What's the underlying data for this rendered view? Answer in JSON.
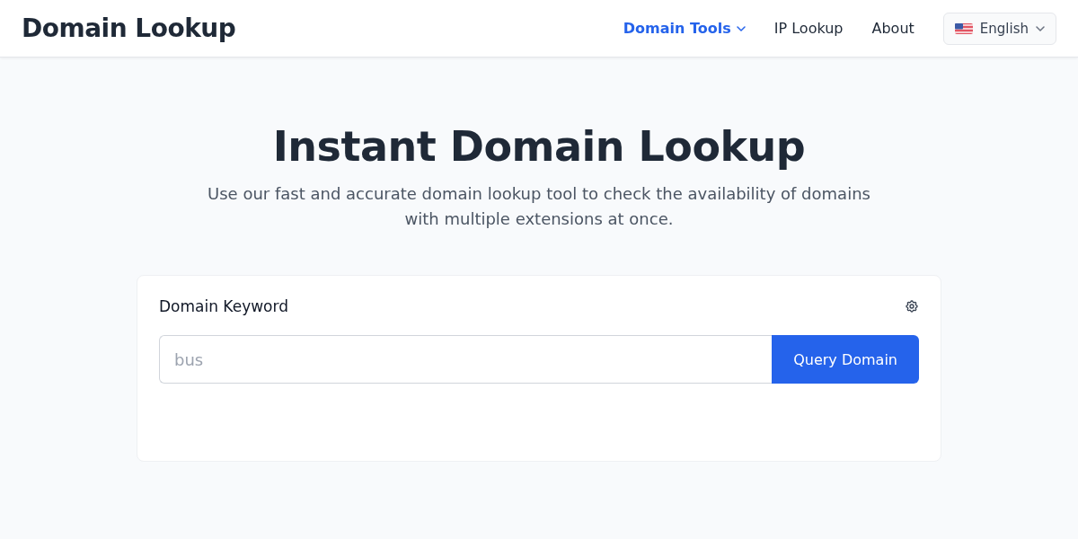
{
  "header": {
    "logo": "Domain Lookup",
    "nav": [
      {
        "label": "Domain Tools",
        "selected": true,
        "dropdown": true
      },
      {
        "label": "IP Lookup",
        "selected": false,
        "dropdown": false
      },
      {
        "label": "About",
        "selected": false,
        "dropdown": false
      }
    ],
    "language": {
      "label": "English"
    }
  },
  "hero": {
    "title": "Instant Domain Lookup",
    "subtitle": "Use our fast and accurate domain lookup tool to check the availability of domains with multiple extensions at once."
  },
  "search_card": {
    "label": "Domain Keyword",
    "field": {
      "placeholder": "bus"
    },
    "button": "Query Domain"
  }
}
